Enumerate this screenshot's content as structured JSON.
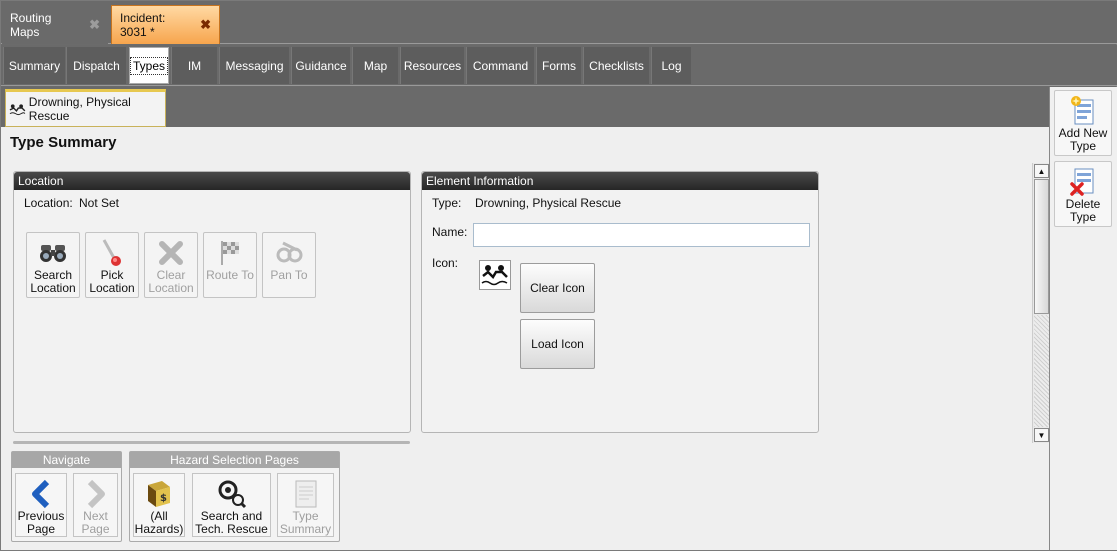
{
  "doc_tabs": [
    {
      "label": "Routing Maps",
      "close": "✖"
    },
    {
      "label": "Incident: 3031 *",
      "close": "✖"
    }
  ],
  "section_tabs": [
    "Summary",
    "Dispatch",
    "Types",
    "IM",
    "Messaging",
    "Guidance",
    "Map",
    "Resources",
    "Command",
    "Forms",
    "Checklists",
    "Log"
  ],
  "active_section": "Types",
  "type_tab": {
    "label": "Drowning, Physical Rescue",
    "icon": "swimmer-icon"
  },
  "page_title": "Type Summary",
  "location_panel": {
    "header": "Location",
    "location_label": "Location:",
    "location_value": "Not Set",
    "buttons": [
      {
        "line1": "Search",
        "line2": "Location",
        "icon": "binoculars-icon",
        "enabled": true
      },
      {
        "line1": "Pick",
        "line2": "Location",
        "icon": "pick-icon",
        "enabled": true
      },
      {
        "line1": "Clear",
        "line2": "Location",
        "icon": "clear-x-icon",
        "enabled": false
      },
      {
        "line1": "Route To",
        "line2": "",
        "icon": "checkered-flag-icon",
        "enabled": false
      },
      {
        "line1": "Pan To",
        "line2": "",
        "icon": "pan-icon",
        "enabled": false
      }
    ]
  },
  "element_panel": {
    "header": "Element Information",
    "type_label": "Type:",
    "type_value": "Drowning, Physical Rescue",
    "name_label": "Name:",
    "name_value": "",
    "icon_label": "Icon:",
    "clear_icon_button": "Clear Icon",
    "load_icon_button": "Load Icon"
  },
  "navigate_group": {
    "header": "Navigate",
    "previous": {
      "line1": "Previous",
      "line2": "Page"
    },
    "next": {
      "line1": "Next",
      "line2": "Page"
    }
  },
  "hazard_group": {
    "header": "Hazard Selection Pages",
    "all_hazards": {
      "line1": "(All",
      "line2": "Hazards)"
    },
    "search_tech": {
      "line1": "Search and",
      "line2": "Tech. Rescue"
    },
    "type_summary": {
      "line1": "Type",
      "line2": "Summary"
    }
  },
  "right_toolbar": {
    "add": {
      "line1": "Add New",
      "line2": "Type"
    },
    "delete": {
      "line1": "Delete",
      "line2": "Type"
    }
  },
  "colors": {
    "incident_tab": "#f7a54d",
    "panel_header": "#262626",
    "nav_arrow": "#1f5fbf"
  }
}
